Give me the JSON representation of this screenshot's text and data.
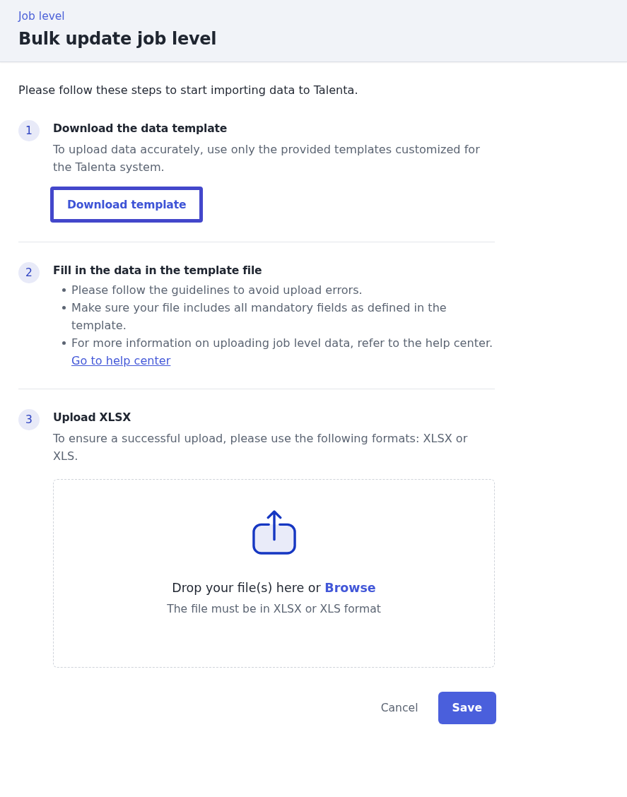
{
  "header": {
    "breadcrumb": "Job level",
    "title": "Bulk update job level"
  },
  "intro": "Please follow these steps to start importing data to Talenta.",
  "steps": [
    {
      "kind": "download",
      "number": "1",
      "title": "Download the data template",
      "description": "To upload data accurately, use only the provided templates customized for the Talenta system.",
      "button": {
        "label": "Download template",
        "focused": true
      }
    },
    {
      "kind": "bullets",
      "number": "2",
      "title": "Fill in the data in the template file",
      "bullets": [
        "Please follow the guidelines to avoid upload errors.",
        "Make sure your file includes all mandatory fields as defined in the template.",
        "For more information on uploading job level data, refer to the help center."
      ],
      "link": "Go to help center"
    },
    {
      "kind": "upload",
      "number": "3",
      "title": "Upload XLSX",
      "description": "To ensure a successful upload, please use the following formats: XLSX or XLS.",
      "dropzone": {
        "prompt": "Drop your file(s) here or",
        "browse": "Browse",
        "hint": "The file must be in XLSX or XLS format"
      }
    }
  ],
  "actions": [
    {
      "kind": "text",
      "label": "Cancel"
    },
    {
      "kind": "primary",
      "label": "Save"
    }
  ]
}
